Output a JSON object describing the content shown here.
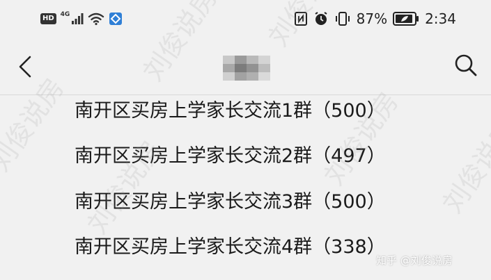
{
  "status_bar": {
    "left_badge": "HD",
    "network": "4G",
    "battery_percent": "87%",
    "time": "2:34",
    "icons": [
      "hd-icon",
      "signal-icon",
      "wifi-icon",
      "app-notification-icon",
      "nfc-icon",
      "alarm-icon",
      "vibrate-icon",
      "battery-icon"
    ]
  },
  "nav": {
    "back_icon": "chevron-left-icon",
    "search_icon": "search-icon"
  },
  "groups": [
    {
      "name": "南开区买房上学家长交流1群（500）"
    },
    {
      "name": "南开区买房上学家长交流2群（497）"
    },
    {
      "name": "南开区买房上学家长交流3群（500）"
    },
    {
      "name": "南开区买房上学家长交流4群（338）"
    }
  ],
  "watermark_text": "刘俊说房",
  "site_credit": "知乎 @刘俊说房"
}
